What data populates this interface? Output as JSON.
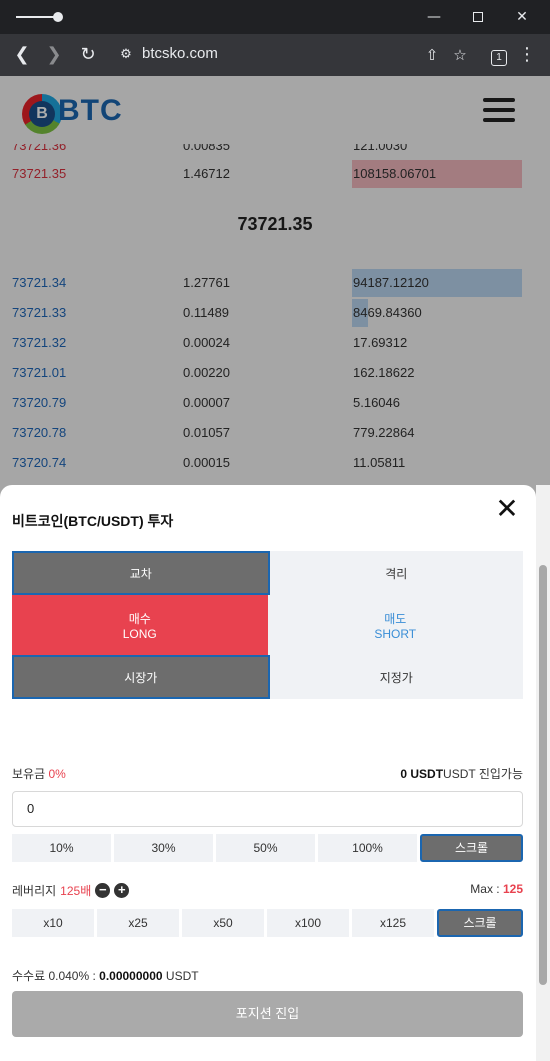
{
  "browser": {
    "url": "btcsko.com",
    "tab_count": "1"
  },
  "site": {
    "logo_text": "BTC",
    "logo_coin_symbol": "B"
  },
  "orderbook": {
    "cut_row": {
      "price": "73721.36",
      "qty": "0.00835",
      "total": "121.0030"
    },
    "sell_rows": [
      {
        "price": "73721.35",
        "qty": "1.46712",
        "total": "108158.06701"
      }
    ],
    "mid_price": "73721.35",
    "buy_rows": [
      {
        "price": "73721.34",
        "qty": "1.27761",
        "total": "94187.12120"
      },
      {
        "price": "73721.33",
        "qty": "0.11489",
        "total": "8469.84360"
      },
      {
        "price": "73721.32",
        "qty": "0.00024",
        "total": "17.69312"
      },
      {
        "price": "73721.01",
        "qty": "0.00220",
        "total": "162.18622"
      },
      {
        "price": "73720.79",
        "qty": "0.00007",
        "total": "5.16046"
      },
      {
        "price": "73720.78",
        "qty": "0.01057",
        "total": "779.22864"
      },
      {
        "price": "73720.74",
        "qty": "0.00015",
        "total": "11.05811"
      }
    ]
  },
  "modal": {
    "title": "비트코인(BTC/USDT) 투자",
    "margin_cross": "교차",
    "margin_isolated": "격리",
    "buy_label": "매수",
    "buy_sub": "LONG",
    "sell_label": "매도",
    "sell_sub": "SHORT",
    "market_label": "시장가",
    "limit_label": "지정가",
    "hold_label": "보유금",
    "hold_pct": "0%",
    "avail_amount": "0 USDT",
    "avail_suffix": "USDT 진입가능",
    "amount_value": "0",
    "pct_options": [
      "10%",
      "30%",
      "50%",
      "100%"
    ],
    "scroll_label": "스크롤",
    "leverage_label": "레버리지",
    "leverage_value": "125배",
    "max_prefix": "Max : ",
    "max_value": "125",
    "leverage_options": [
      "x10",
      "x25",
      "x50",
      "x100",
      "x125"
    ],
    "fee_label": "수수료 0.040% : ",
    "fee_amount": "0.00000000",
    "fee_unit": " USDT",
    "submit_label": "포지션 진입"
  }
}
